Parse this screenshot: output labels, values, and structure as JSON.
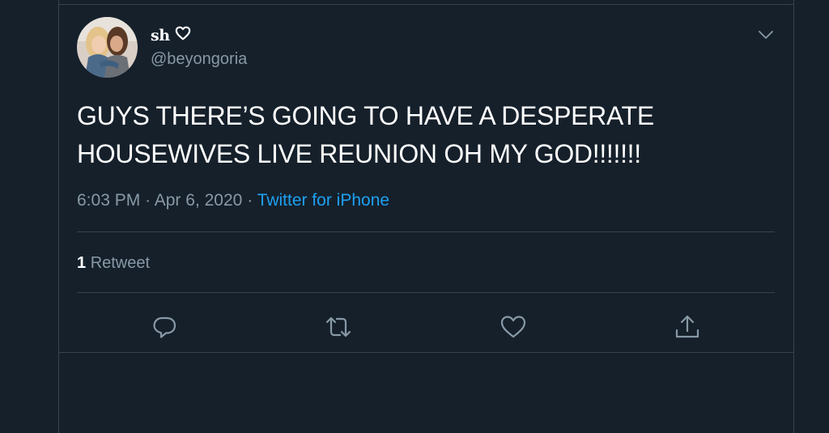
{
  "tweet": {
    "display_name": "sh",
    "handle": "@beyongoria",
    "text_lines": [
      "GUYS THERE’S GOING TO HAVE A DESPERATE",
      "HOUSEWIVES LIVE REUNION OH MY GOD!!!!!!!"
    ],
    "time": "6:03 PM",
    "date": "Apr 6, 2020",
    "separator": "·",
    "source": "Twitter for iPhone",
    "retweet_count": "1",
    "retweet_label": "Retweet"
  },
  "icons": {
    "name_badge": "heart-outline-icon",
    "caret": "chevron-down-icon",
    "reply": "reply-icon",
    "retweet": "retweet-icon",
    "like": "like-icon",
    "share": "share-icon"
  },
  "colors": {
    "background": "#15202b",
    "border": "#38444d",
    "secondary_text": "#8899a6",
    "link": "#1da1f2",
    "primary_text": "#ffffff"
  }
}
